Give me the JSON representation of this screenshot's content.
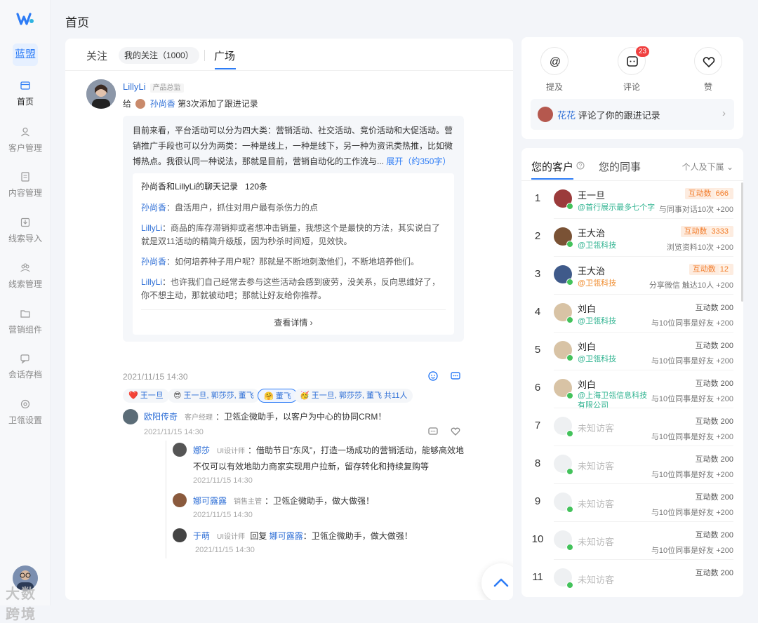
{
  "page_title": "首页",
  "sidebar": {
    "org": "蓝盟",
    "items": [
      {
        "label": "首页",
        "icon": "home-icon"
      },
      {
        "label": "客户管理",
        "icon": "user-icon"
      },
      {
        "label": "内容管理",
        "icon": "document-icon"
      },
      {
        "label": "线索导入",
        "icon": "import-icon"
      },
      {
        "label": "线索管理",
        "icon": "group-icon"
      },
      {
        "label": "营销组件",
        "icon": "folder-icon"
      },
      {
        "label": "会话存档",
        "icon": "chat-icon"
      },
      {
        "label": "卫瓴设置",
        "icon": "settings-icon"
      }
    ],
    "watermark": "大数跨境"
  },
  "feed": {
    "tabs": {
      "follow": "关注",
      "my_follow": "我的关注（1000）",
      "square": "广场"
    },
    "post": {
      "author": "LillyLi",
      "role": "产品总监",
      "action_prefix": "给",
      "target": "孙尚香",
      "action": "第3次添加了跟进记录",
      "body": "目前来看，平台活动可以分为四大类：营销活动、社交活动、竞价活动和大促活动。营销推广手段也可以分为两类：一种是线上，一种是线下，另一种为资讯类热推，比如微博热点。我很认同一种说法，那就是目前，营销自动化的工作流与...",
      "expand": "展开（约350字）",
      "chat": {
        "title": "孙尚香和LillyLi的聊天记录",
        "count": "120条",
        "lines": [
          {
            "speaker": "孙尚香",
            "text": "：盘活用户，抓住对用户最有杀伤力的点"
          },
          {
            "speaker": "LillyLi",
            "text": "：商品的库存滞销抑或者想冲击销量，我想这个是最快的方法，其实说白了就是双11活动的精简升级版，因为秒杀时间短，见效快。"
          },
          {
            "speaker": "孙尚香",
            "text": "：如何培养种子用户呢？那就是不断地刺激他们，不断地培养他们。"
          },
          {
            "speaker": "LillyLi",
            "text": "：也许我们自己经常去参与这些活动会感到疲劳，没关系，反向思维好了，你不想主动，那就被动吧；那就让好友给你推荐。"
          }
        ],
        "view_detail": "查看详情"
      },
      "time": "2021/11/15 14:30",
      "reactions": [
        {
          "emoji": "❤️",
          "names": "王一旦"
        },
        {
          "emoji": "😎",
          "names": "王一旦, 郭莎莎, 董飞"
        },
        {
          "emoji": "🤗",
          "names": "董飞"
        },
        {
          "emoji": "🥳",
          "names": "王一旦, 郭莎莎, 董飞  共11人"
        }
      ],
      "comments": [
        {
          "name": "欧阳传奇",
          "role": "客户经理",
          "text": "：卫瓴企微助手，以客户为中心的协同CRM！",
          "time": "2021/11/15 14:30"
        },
        {
          "name": "娜莎",
          "role": "UI设计师",
          "text": "：借助节日“东风”，打造一场成功的营销活动，能够高效地",
          "text2": "不仅可以有效地助力商家实现用户拉新，留存转化和持续复购等",
          "time": "2021/11/15 14:30"
        },
        {
          "name": "娜可露露",
          "role": "销售主管",
          "text": "：卫瓴企微助手，做大做强！",
          "time": "2021/11/15 14:30"
        },
        {
          "name": "于萌",
          "role": "UI设计师",
          "reply_word": "回复",
          "reply_to": "娜可露露",
          "text": "：卫瓴企微助手，做大做强！",
          "time": "2021/11/15 14:30"
        }
      ]
    }
  },
  "notifications": {
    "mention": "提及",
    "comment": "评论",
    "comment_badge": "23",
    "like": "赞",
    "latest_user": "花花",
    "latest_text": "评论了你的跟进记录"
  },
  "customers": {
    "tab_customers": "您的客户",
    "tab_colleagues": "您的同事",
    "filter": "个人及下属",
    "rows": [
      {
        "rank": "1",
        "name": "王一旦",
        "company": "@首行展示最多七个字",
        "company_color": "green",
        "active_label": "互动数",
        "active_value": "666",
        "highlight": true,
        "desc": "与同事对话10次 +200"
      },
      {
        "rank": "2",
        "name": "王大治",
        "company": "@卫瓴科技",
        "company_color": "green",
        "active_label": "互动数",
        "active_value": "3333",
        "highlight": true,
        "desc": "浏览资料10次 +200"
      },
      {
        "rank": "3",
        "name": "王大治",
        "company": "@卫瓴科技",
        "company_color": "orange",
        "active_label": "互动数",
        "active_value": "12",
        "highlight": true,
        "desc": "分享微信 触达10人 +200"
      },
      {
        "rank": "4",
        "name": "刘白",
        "company": "@卫瓴科技",
        "company_color": "green",
        "active_label": "互动数 200",
        "highlight": false,
        "desc": "与10位同事是好友 +200"
      },
      {
        "rank": "5",
        "name": "刘白",
        "company": "@卫瓴科技",
        "company_color": "green",
        "active_label": "互动数 200",
        "highlight": false,
        "desc": "与10位同事是好友 +200"
      },
      {
        "rank": "6",
        "name": "刘白",
        "company": "@上海卫瓴信息科技有限公司",
        "company_color": "green",
        "active_label": "互动数 200",
        "highlight": false,
        "desc": "与10位同事是好友 +200"
      },
      {
        "rank": "7",
        "name": "未知访客",
        "company": "",
        "active_label": "互动数 200",
        "highlight": false,
        "desc": "与10位同事是好友 +200"
      },
      {
        "rank": "8",
        "name": "未知访客",
        "company": "",
        "active_label": "互动数 200",
        "highlight": false,
        "desc": "与10位同事是好友 +200"
      },
      {
        "rank": "9",
        "name": "未知访客",
        "company": "",
        "active_label": "互动数 200",
        "highlight": false,
        "desc": "与10位同事是好友 +200"
      },
      {
        "rank": "10",
        "name": "未知访客",
        "company": "",
        "active_label": "互动数 200",
        "highlight": false,
        "desc": "与10位同事是好友 +200"
      },
      {
        "rank": "11",
        "name": "未知访客",
        "company": "",
        "active_label": "互动数 200",
        "highlight": false,
        "desc": ""
      }
    ]
  },
  "colors": {
    "accent": "#2d7cf6",
    "orange": "#f27c2a",
    "green": "#2fb390"
  }
}
